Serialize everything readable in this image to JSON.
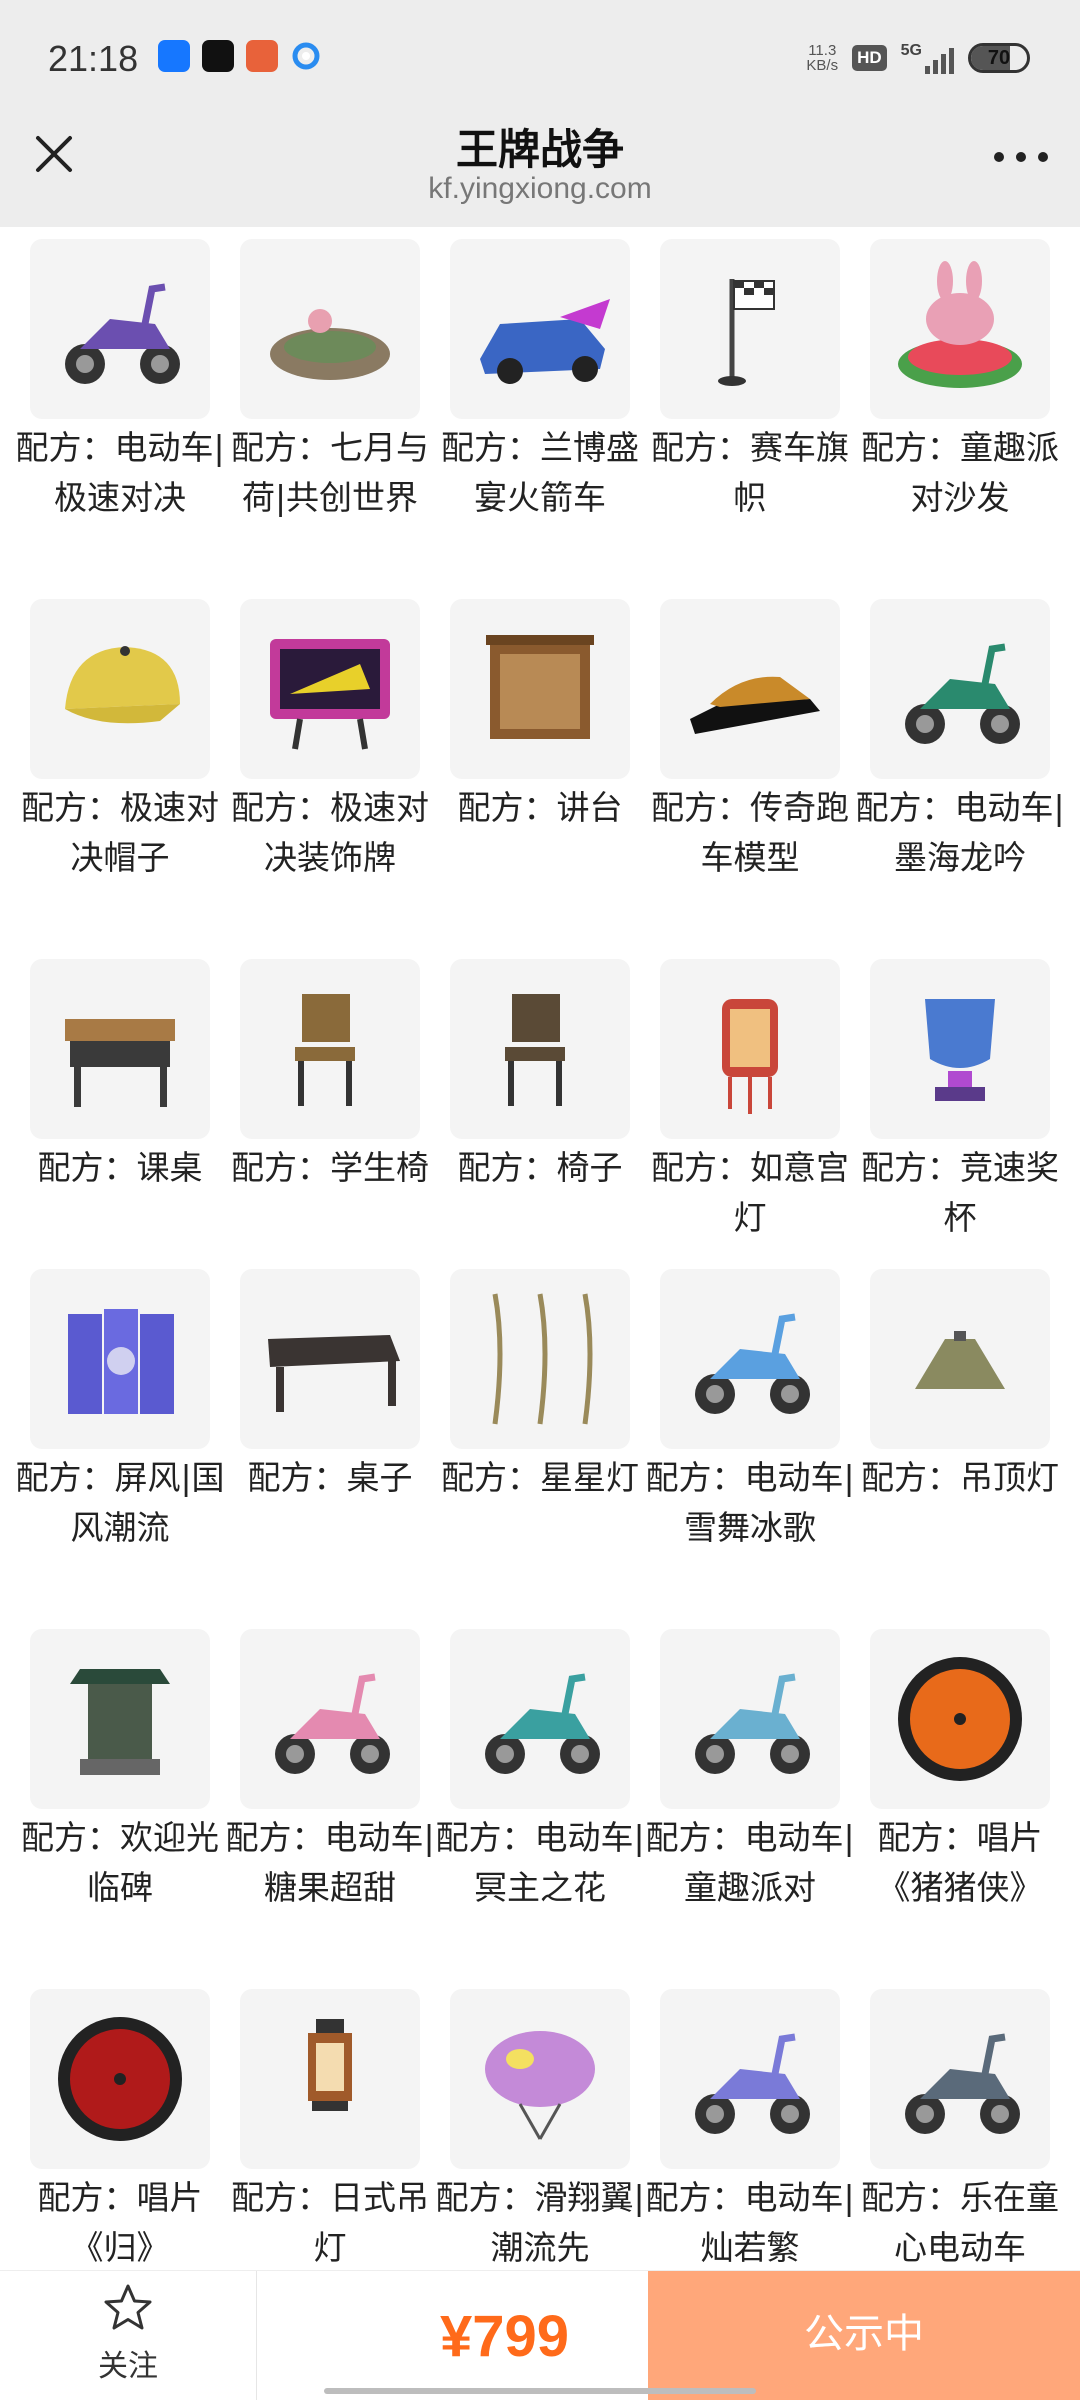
{
  "status_bar": {
    "time": "21:18",
    "net_speed_value": "11.3",
    "net_speed_unit": "KB/s",
    "hd_badge": "HD",
    "network": "5G",
    "battery_level": "70",
    "app_icons": [
      "alipay-icon",
      "tiktok-icon",
      "game-app-icon",
      "browser-icon"
    ]
  },
  "header": {
    "title": "王牌战争",
    "url": "kf.yingxiong.com",
    "close_icon": "close-icon",
    "more_icon": "more-icon"
  },
  "items": [
    {
      "label": "配方：电动车|极速对决",
      "icon": "scooter-icon"
    },
    {
      "label": "配方：七月与荷|共创世界",
      "icon": "lotus-pond-icon"
    },
    {
      "label": "配方：兰博盛宴火箭车",
      "icon": "rocket-car-icon"
    },
    {
      "label": "配方：赛车旗帜",
      "icon": "flag-icon"
    },
    {
      "label": "配方：童趣派对沙发",
      "icon": "sofa-icon"
    },
    {
      "label": "配方：极速对决帽子",
      "icon": "cap-icon"
    },
    {
      "label": "配方：极速对决装饰牌",
      "icon": "sign-icon"
    },
    {
      "label": "配方：讲台",
      "icon": "podium-icon"
    },
    {
      "label": "配方：传奇跑车模型",
      "icon": "car-model-icon"
    },
    {
      "label": "配方：电动车|墨海龙吟",
      "icon": "scooter-icon"
    },
    {
      "label": "配方：课桌",
      "icon": "desk-icon"
    },
    {
      "label": "配方：学生椅",
      "icon": "chair-icon"
    },
    {
      "label": "配方：椅子",
      "icon": "chair-icon"
    },
    {
      "label": "配方：如意宫灯",
      "icon": "lantern-icon"
    },
    {
      "label": "配方：竞速奖杯",
      "icon": "trophy-icon"
    },
    {
      "label": "配方：屏风|国风潮流",
      "icon": "screen-icon"
    },
    {
      "label": "配方：桌子",
      "icon": "table-icon"
    },
    {
      "label": "配方：星星灯",
      "icon": "string-lights-icon"
    },
    {
      "label": "配方：电动车|雪舞冰歌",
      "icon": "scooter-icon"
    },
    {
      "label": "配方：吊顶灯",
      "icon": "ceiling-lamp-icon"
    },
    {
      "label": "配方：欢迎光临碑",
      "icon": "stele-icon"
    },
    {
      "label": "配方：电动车|糖果超甜",
      "icon": "scooter-icon"
    },
    {
      "label": "配方：电动车|冥主之花",
      "icon": "scooter-icon"
    },
    {
      "label": "配方：电动车|童趣派对",
      "icon": "scooter-icon"
    },
    {
      "label": "配方：唱片《猪猪侠》",
      "icon": "record-icon"
    },
    {
      "label": "配方：唱片《归》",
      "icon": "record-icon"
    },
    {
      "label": "配方：日式吊灯",
      "icon": "lamp-icon"
    },
    {
      "label": "配方：滑翔翼|潮流先",
      "icon": "glider-icon"
    },
    {
      "label": "配方：电动车|灿若繁",
      "icon": "scooter-icon"
    },
    {
      "label": "配方：乐在童心电动车",
      "icon": "scooter-icon"
    }
  ],
  "item_colors": [
    "#6b4fb0",
    "#6d8a5a",
    "#3a66c4",
    "#444444",
    "#e9a0b5",
    "#e2c94a",
    "#c23a9a",
    "#8a5a2e",
    "#c98a2a",
    "#2a8a6e",
    "#3a3a3a",
    "#8a6a3a",
    "#5a4a36",
    "#c9463a",
    "#4a7ad0",
    "#5a5ad0",
    "#3a3432",
    "#9a8a5a",
    "#5aa0e0",
    "#8a8a60",
    "#4a5a4a",
    "#e48ab0",
    "#3aa0a0",
    "#6ab0d0",
    "#e86a1a",
    "#b01a1a",
    "#a05a2a",
    "#c48ad8",
    "#7a7ad8",
    "#5a6a7a"
  ],
  "bottom_bar": {
    "follow_label": "关注",
    "price": "¥799",
    "status_button": "公示中"
  }
}
